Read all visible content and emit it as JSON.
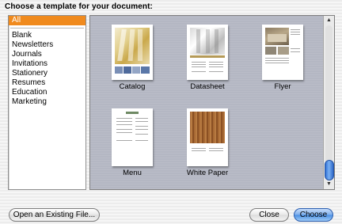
{
  "dialog": {
    "heading": "Choose a template for your document:"
  },
  "categories": {
    "selected": "All",
    "items": [
      "Blank",
      "Newsletters",
      "Journals",
      "Invitations",
      "Stationery",
      "Resumes",
      "Education",
      "Marketing"
    ]
  },
  "templates": [
    {
      "label": "Catalog"
    },
    {
      "label": "Datasheet"
    },
    {
      "label": "Flyer"
    },
    {
      "label": "Menu"
    },
    {
      "label": "White Paper"
    }
  ],
  "buttons": {
    "open_existing": "Open an Existing File...",
    "close": "Close",
    "choose": "Choose"
  },
  "scrollbar": {
    "up_icon": "▲",
    "down_icon": "▼"
  },
  "colors": {
    "selection": "#f08a1d",
    "preview_bg": "#b4b7c3",
    "default_button": "#4b8fe3"
  }
}
